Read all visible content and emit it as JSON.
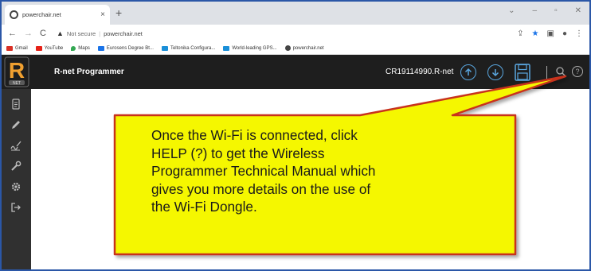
{
  "browser": {
    "tab_title": "powerchair.net",
    "tab_close": "×",
    "new_tab": "+",
    "window_controls": [
      "⌄",
      "–",
      "▫",
      "✕"
    ],
    "security_label": "Not secure",
    "url": "powerchair.net"
  },
  "bookmarks": [
    {
      "label": "Gmail",
      "color": "#d93025"
    },
    {
      "label": "YouTube",
      "color": "#e62117"
    },
    {
      "label": "Maps",
      "color": "#34a853"
    },
    {
      "label": "Eurosens Degree Bt...",
      "color": "#1a73e8"
    },
    {
      "label": "Teltonika Configura...",
      "color": "#1a8fd8"
    },
    {
      "label": "World-leading GPS...",
      "color": "#1a8fd8"
    },
    {
      "label": "powerchair.net",
      "color": "#444444"
    }
  ],
  "app": {
    "title": "R-net Programmer",
    "filename": "CR19114990.R-net",
    "accent": "#5aa7e0",
    "help_label": "?"
  },
  "sidebar": {
    "items": [
      {
        "icon": "document-icon"
      },
      {
        "icon": "pencil-icon"
      },
      {
        "icon": "signature-icon"
      },
      {
        "icon": "wrench-icon"
      },
      {
        "icon": "gear-icon"
      },
      {
        "icon": "logout-icon"
      }
    ]
  },
  "callout": {
    "text": "Once the Wi-Fi is connected, click\nHELP (?) to get the Wireless\nProgrammer Technical Manual which\ngives you more details on the use of\nthe Wi-Fi Dongle.",
    "fill": "#f5f700",
    "border": "#c8321e"
  }
}
